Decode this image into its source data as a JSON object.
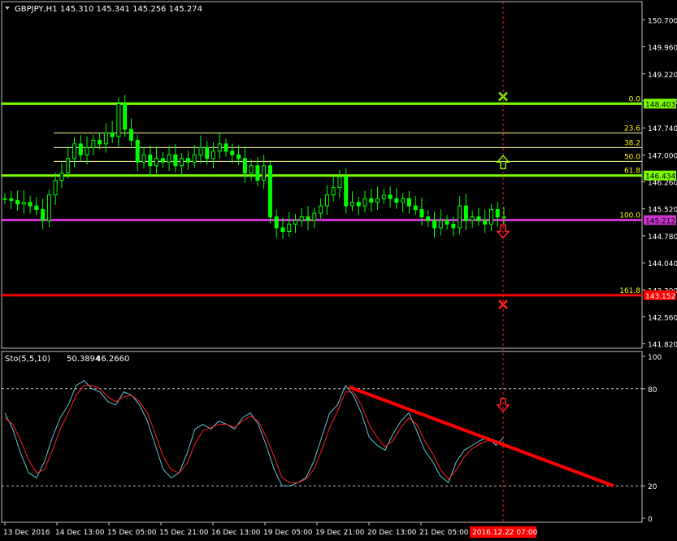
{
  "header": {
    "symbol": "GBPJPY,H1",
    "ohlc": "145.310 145.341 145.256 145.274"
  },
  "colors": {
    "background": "#000000",
    "frame": "#c0c0c0",
    "bull_candle": "#00ff00",
    "bear_candle": "#00ff00",
    "fib_main": "#7cfc00",
    "fib_minor": "#ffff99",
    "fib_label": "#ffff00",
    "price_line": "#cc33cc",
    "stop_line": "#ff0000",
    "stoch_main": "#5fc6d6",
    "stoch_signal": "#ff2020",
    "trendline": "#ff0000",
    "time_marker_bg": "#ff0000"
  },
  "chart_data": {
    "type": "candlestick",
    "symbol": "GBPJPY",
    "timeframe": "H1",
    "price_axis": {
      "ylim": [
        141.7,
        151.2
      ],
      "ticks": [
        "150.700",
        "149.960",
        "149.220",
        "148.480",
        "147.740",
        "147.000",
        "146.260",
        "145.520",
        "144.780",
        "144.040",
        "143.300",
        "142.560",
        "141.820"
      ]
    },
    "time_axis": {
      "labels": [
        "13 Dec 2016",
        "14 Dec 13:00",
        "15 Dec 05:00",
        "15 Dec 21:00",
        "16 Dec 13:00",
        "19 Dec 05:00",
        "19 Dec 21:00",
        "20 Dec 13:00",
        "21 Dec 05:00"
      ],
      "current_time_label": "2016.12.22 07:00"
    },
    "close_path": [
      145.8,
      145.75,
      145.65,
      145.7,
      145.6,
      145.5,
      145.2,
      145.9,
      146.3,
      146.5,
      146.9,
      147.3,
      147.0,
      147.2,
      147.4,
      147.3,
      147.6,
      147.5,
      148.4,
      147.7,
      147.4,
      146.8,
      147.0,
      146.7,
      146.9,
      146.8,
      147.0,
      146.7,
      146.9,
      146.8,
      147.0,
      147.2,
      146.9,
      147.1,
      147.3,
      147.1,
      147.0,
      146.9,
      146.5,
      146.7,
      146.3,
      146.7,
      145.3,
      145.0,
      144.9,
      145.1,
      145.2,
      145.3,
      145.2,
      145.4,
      145.6,
      145.9,
      146.1,
      146.4,
      145.6,
      145.7,
      145.6,
      145.8,
      145.7,
      145.8,
      145.9,
      145.8,
      145.7,
      145.8,
      145.6,
      145.5,
      145.3,
      145.2,
      145.0,
      145.2,
      145.1,
      145.0,
      145.6,
      145.2,
      145.3,
      145.2,
      145.1,
      145.5,
      145.3,
      145.274
    ],
    "fibonacci": {
      "levels": [
        {
          "label": "0.0",
          "price": 148.403,
          "price_label": "148.403",
          "bold": true
        },
        {
          "label": "23.6",
          "price": 147.6,
          "bold": false
        },
        {
          "label": "38.2",
          "price": 147.2,
          "bold": false
        },
        {
          "label": "50.0",
          "price": 146.82,
          "bold": false
        },
        {
          "label": "61.8",
          "price": 146.434,
          "price_label": "146.434",
          "bold": true
        },
        {
          "label": "100.0",
          "price": 145.212,
          "price_label": "145.212",
          "bold": false
        },
        {
          "label": "161.8",
          "price": 143.152,
          "price_label": "143.152",
          "bold": false
        }
      ]
    },
    "stop_level": 143.152,
    "markers": [
      {
        "type": "cross",
        "price": 148.6,
        "color": "#7cfc00"
      },
      {
        "type": "arrow-up",
        "price": 146.8,
        "color": "#7cfc00"
      },
      {
        "type": "arrow-down",
        "price": 144.9,
        "color": "#ff2020"
      },
      {
        "type": "cross",
        "price": 142.9,
        "color": "#ff2020"
      }
    ],
    "stochastic": {
      "label": "Sto(5,5,10)",
      "main_value": "50.3894",
      "signal_value": "46.2660",
      "ylim": [
        0,
        100
      ],
      "ticks": [
        "100",
        "80",
        "20",
        "0"
      ],
      "levels": [
        80,
        20
      ],
      "main": [
        65,
        55,
        40,
        28,
        25,
        35,
        50,
        62,
        70,
        82,
        85,
        80,
        78,
        72,
        70,
        78,
        76,
        70,
        60,
        45,
        30,
        25,
        28,
        40,
        55,
        58,
        55,
        60,
        58,
        55,
        62,
        65,
        58,
        45,
        30,
        20,
        20,
        22,
        25,
        35,
        50,
        65,
        70,
        82,
        76,
        65,
        50,
        45,
        42,
        52,
        60,
        65,
        54,
        42,
        35,
        26,
        22,
        35,
        42,
        45,
        48,
        50,
        45,
        50
      ],
      "signal": [
        62,
        58,
        48,
        36,
        28,
        30,
        42,
        55,
        65,
        76,
        82,
        82,
        80,
        75,
        72,
        75,
        76,
        72,
        65,
        52,
        38,
        30,
        28,
        34,
        46,
        54,
        56,
        58,
        58,
        56,
        60,
        63,
        60,
        50,
        38,
        25,
        22,
        22,
        24,
        30,
        42,
        56,
        66,
        78,
        78,
        70,
        58,
        50,
        44,
        48,
        56,
        62,
        58,
        48,
        40,
        30,
        24,
        30,
        38,
        43,
        46,
        48,
        47,
        46
      ],
      "trendline": [
        {
          "t": 0.69,
          "v": 81
        },
        {
          "t": 1.22,
          "v": 20
        }
      ],
      "markers": [
        {
          "type": "arrow-down",
          "v": 70,
          "color": "#ff2020"
        }
      ]
    }
  }
}
